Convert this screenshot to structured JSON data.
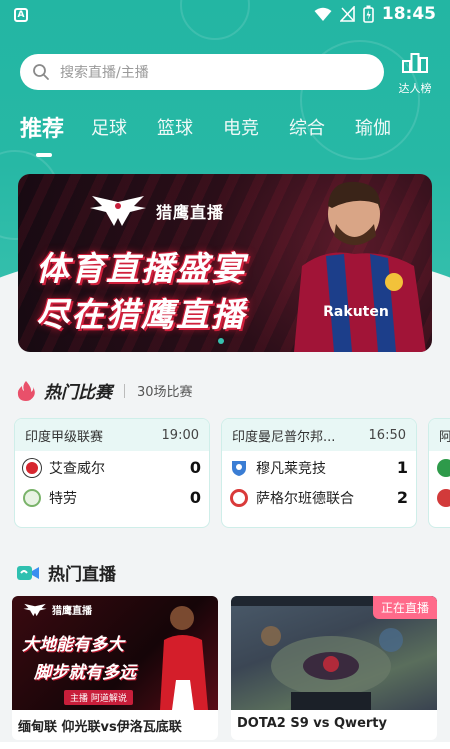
{
  "status_bar": {
    "time": "18:45"
  },
  "search": {
    "placeholder": "搜索直播/主播"
  },
  "ranking": {
    "label": "达人榜"
  },
  "tabs": [
    {
      "label": "推荐",
      "active": true
    },
    {
      "label": "足球",
      "active": false
    },
    {
      "label": "篮球",
      "active": false
    },
    {
      "label": "电竞",
      "active": false
    },
    {
      "label": "综合",
      "active": false
    },
    {
      "label": "瑜伽",
      "active": false
    }
  ],
  "banner": {
    "brand": "猎鹰直播",
    "line1": "体育直播盛宴",
    "line2": "尽在猎鹰直播",
    "jersey_text": "Rakuten"
  },
  "hot_matches": {
    "title": "热门比赛",
    "count": "30场比赛",
    "matches": [
      {
        "league": "印度甲级联赛",
        "time": "19:00",
        "home": {
          "name": "艾查威尔",
          "score": "0"
        },
        "away": {
          "name": "特劳",
          "score": "0"
        }
      },
      {
        "league": "印度曼尼普尔邦...",
        "time": "16:50",
        "home": {
          "name": "穆凡莱竞技",
          "score": "1"
        },
        "away": {
          "name": "萨格尔班德联合",
          "score": "2"
        }
      },
      {
        "league": "阿",
        "time": "",
        "home": {
          "name": "",
          "score": ""
        },
        "away": {
          "name": "",
          "score": ""
        }
      }
    ]
  },
  "hot_live": {
    "title": "热门直播",
    "items": [
      {
        "title": "缅甸联 仰光联vs伊洛瓦底联",
        "thumb_brand": "猎鹰直播",
        "thumb_line1": "大地能有多大",
        "thumb_line2": "脚步就有多远",
        "thumb_tag": "主播 阿道解说"
      },
      {
        "title": "DOTA2 S9 vs Qwerty",
        "live_tag": "正在直播"
      }
    ]
  },
  "colors": {
    "brand": "#27b8a5",
    "live_tag": "#ff6a8a"
  }
}
